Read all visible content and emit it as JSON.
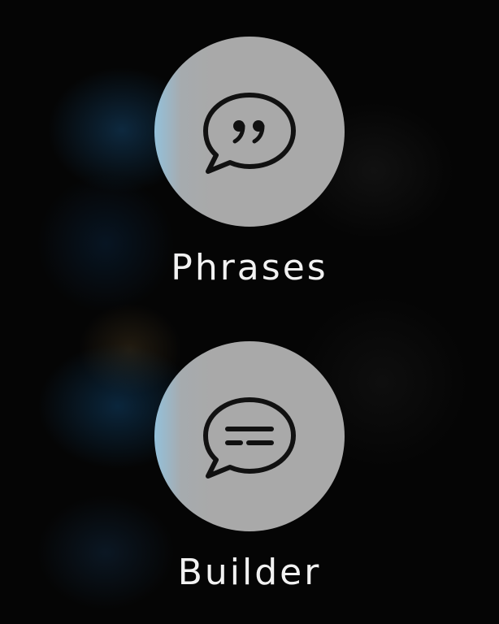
{
  "menu": {
    "items": [
      {
        "label": "Phrases",
        "icon": "quote-speech-bubble-icon"
      },
      {
        "label": "Builder",
        "icon": "lines-speech-bubble-icon"
      }
    ]
  },
  "colors": {
    "background": "#000000",
    "button_fill": "#a9a9a9",
    "icon_stroke": "#111111",
    "label_text": "#f2f2f2",
    "accent_tint": "#8cc8eb"
  }
}
